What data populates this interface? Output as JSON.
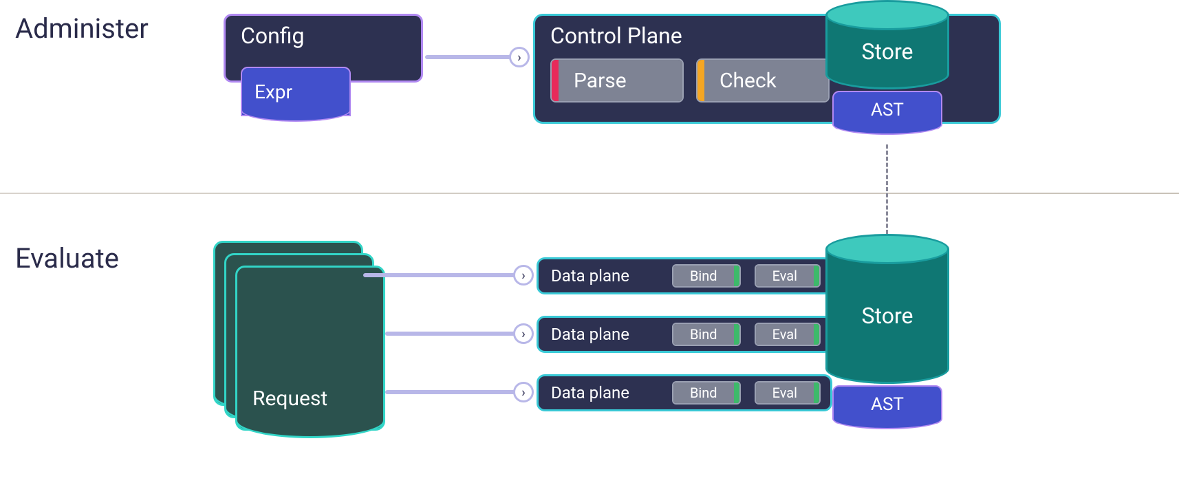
{
  "sections": {
    "administer": "Administer",
    "evaluate": "Evaluate"
  },
  "config": {
    "title": "Config",
    "expr": "Expr"
  },
  "control_plane": {
    "title": "Control Plane",
    "parse": "Parse",
    "check": "Check"
  },
  "store": {
    "top_label": "Store",
    "bottom_label": "Store",
    "ast": "AST"
  },
  "data_plane": {
    "title": "Data plane",
    "bind": "Bind",
    "eval": "Eval"
  },
  "request": "Request",
  "colors": {
    "parse_stripe": "#e82a5a",
    "check_stripe": "#f5a623",
    "eval_stripe": "#3db96a"
  }
}
